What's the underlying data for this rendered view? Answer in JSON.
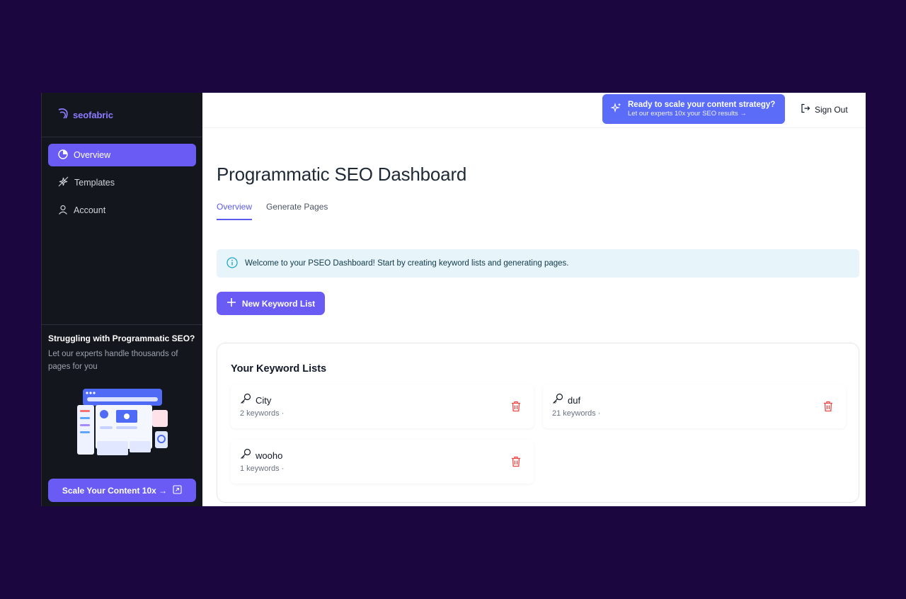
{
  "brand": {
    "name": "seofabric"
  },
  "sidebar": {
    "items": [
      {
        "label": "Overview",
        "icon": "pie-chart-icon",
        "active": true
      },
      {
        "label": "Templates",
        "icon": "sparkle-icon",
        "active": false
      },
      {
        "label": "Account",
        "icon": "user-icon",
        "active": false
      }
    ],
    "promo": {
      "title": "Struggling with Programmatic SEO?",
      "subtitle": "Let our experts handle thousands of pages for you",
      "button_label": "Scale Your Content 10x →"
    }
  },
  "topbar": {
    "cta_title": "Ready to scale your content strategy?",
    "cta_subtitle": "Let our experts 10x your SEO results →",
    "signout_label": "Sign Out"
  },
  "main": {
    "title": "Programmatic SEO Dashboard",
    "tabs": [
      {
        "label": "Overview",
        "active": true
      },
      {
        "label": "Generate Pages",
        "active": false
      }
    ],
    "alert_text": "Welcome to your PSEO Dashboard! Start by creating keyword lists and generating pages.",
    "new_button_label": "New Keyword List",
    "lists_title": "Your Keyword Lists",
    "keyword_lists": [
      {
        "name": "City",
        "count": "2 keywords ·"
      },
      {
        "name": "duf",
        "count": "21 keywords ·"
      },
      {
        "name": "wooho",
        "count": "1 keywords ·"
      }
    ]
  },
  "colors": {
    "background": "#1b0640",
    "sidebar": "#14161d",
    "accent": "#6a5bf5",
    "cta": "#5b6cf9",
    "alert_bg": "#e7f4f9",
    "delete": "#ef4444"
  }
}
